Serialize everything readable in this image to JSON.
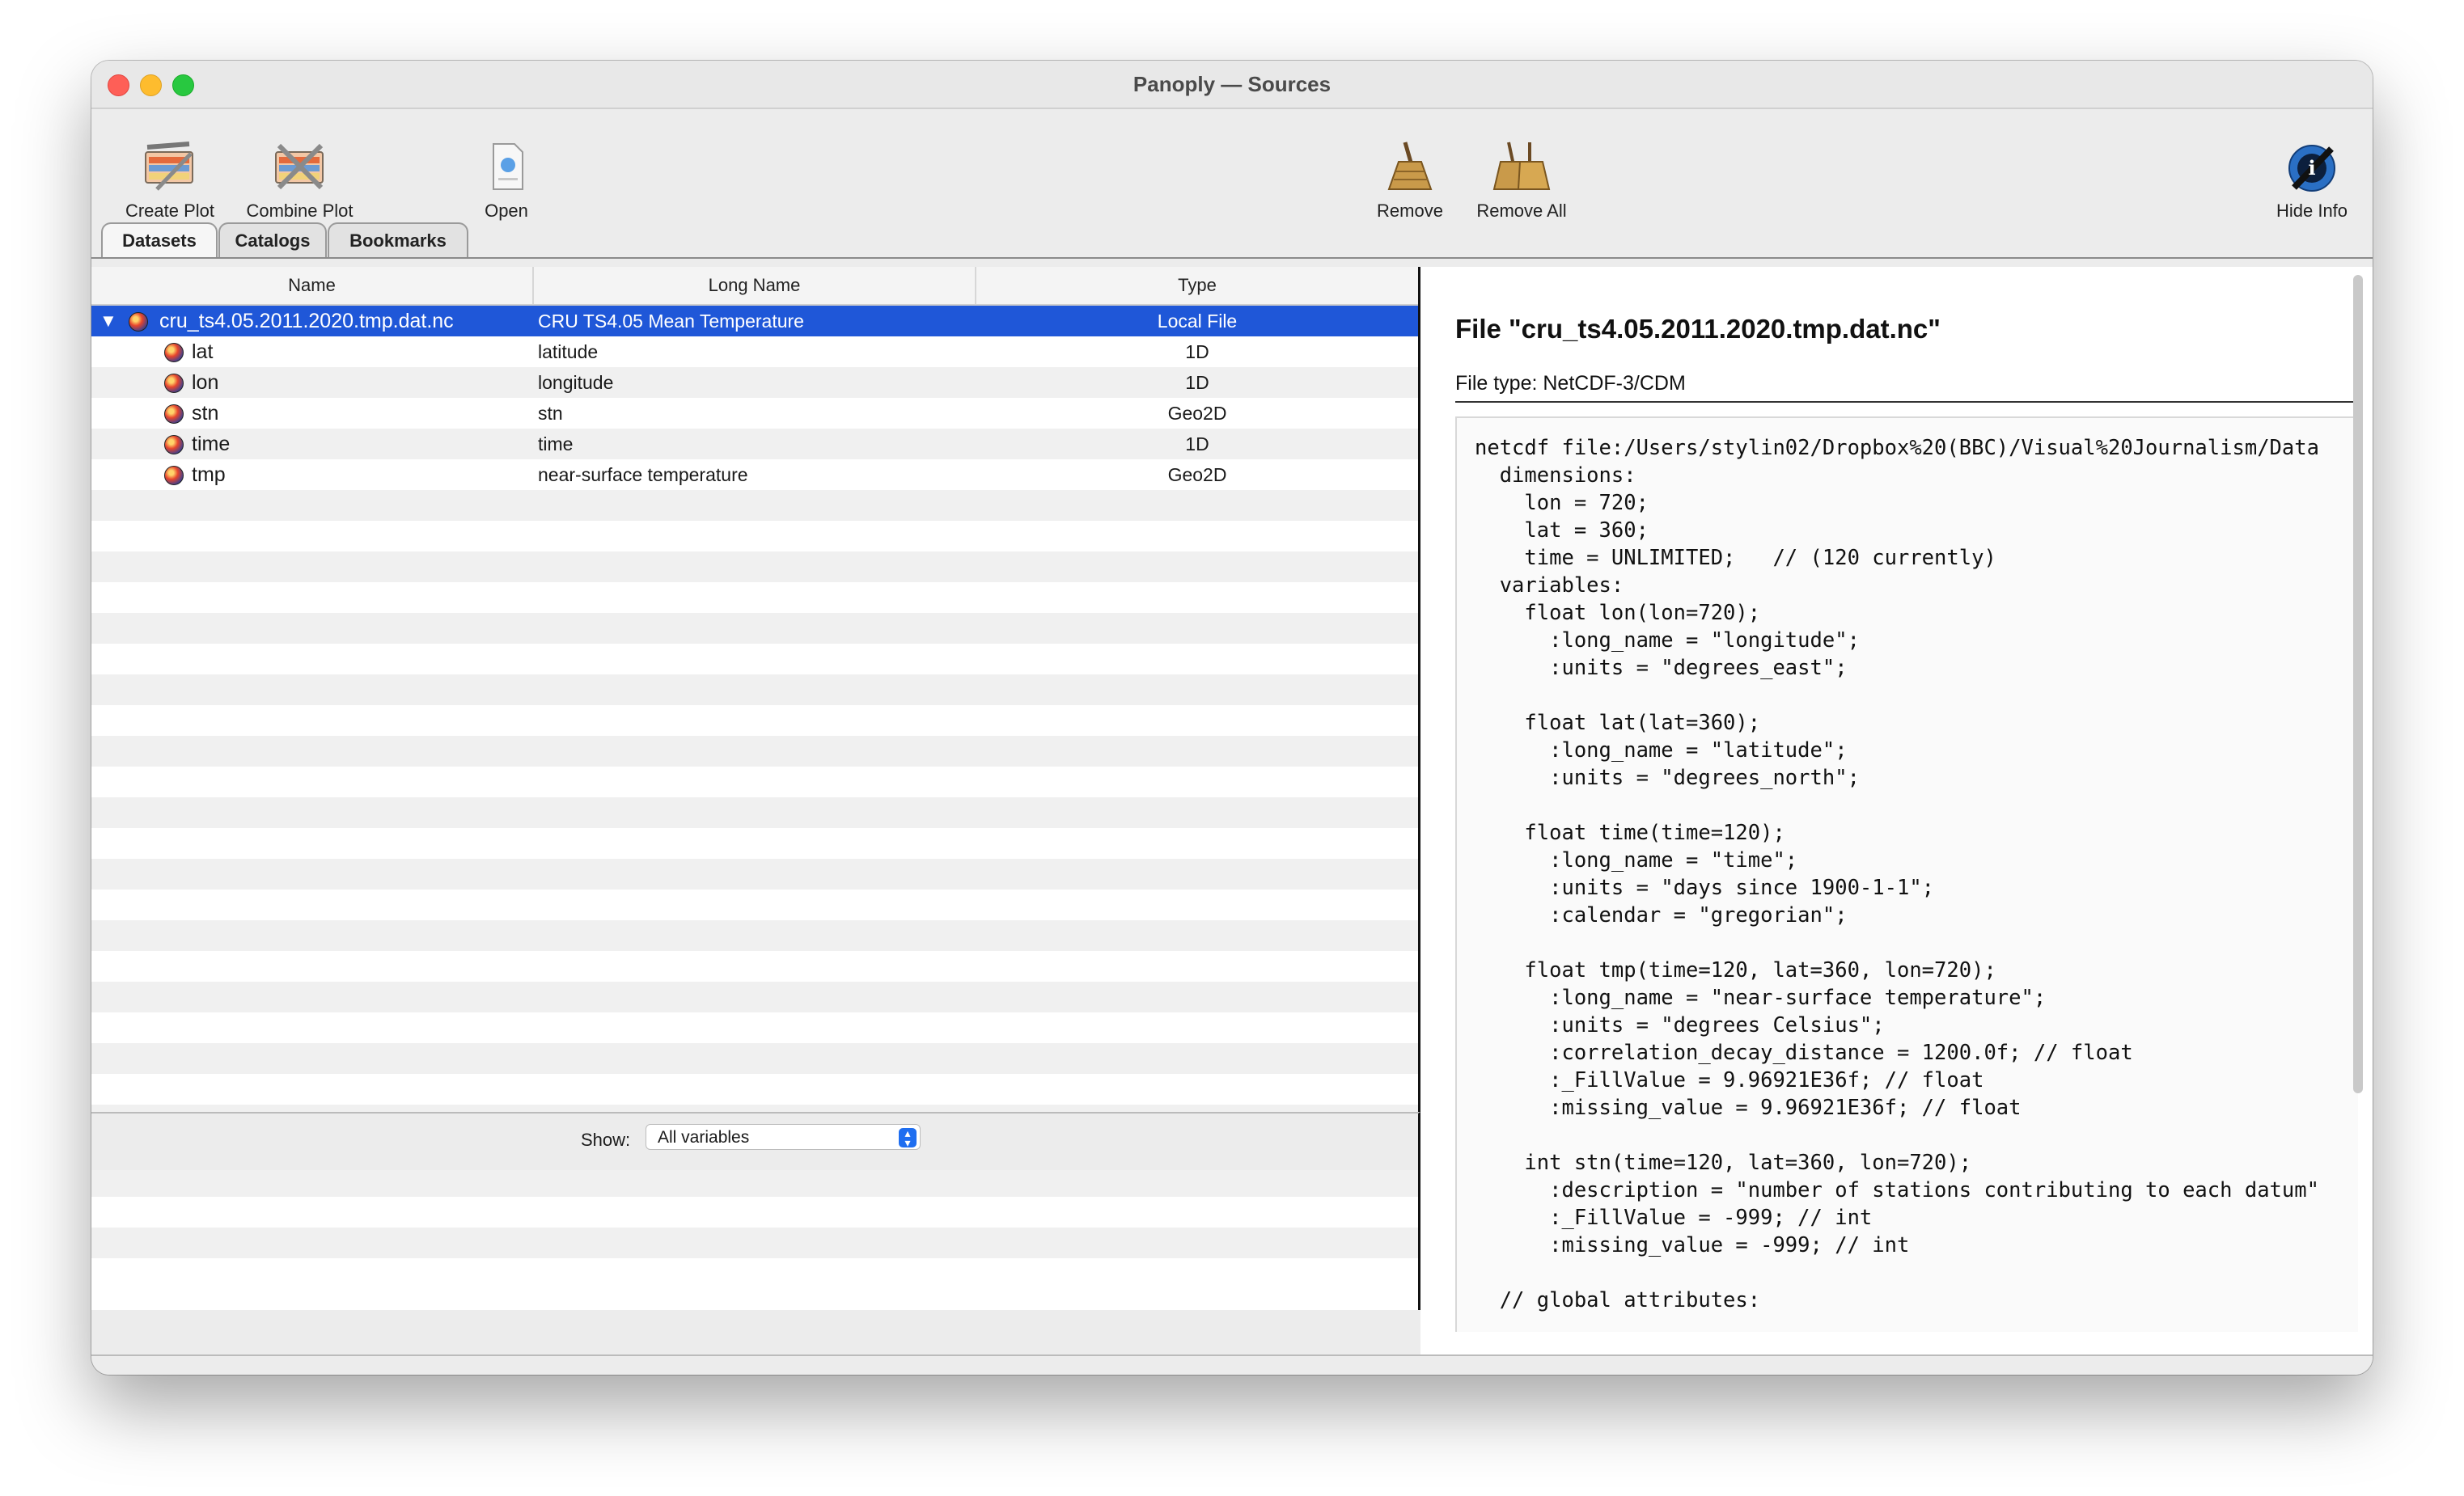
{
  "window": {
    "title": "Panoply — Sources"
  },
  "toolbar": {
    "create_plot": "Create Plot",
    "combine_plot": "Combine Plot",
    "open": "Open",
    "remove": "Remove",
    "remove_all": "Remove All",
    "hide_info": "Hide Info"
  },
  "tabs": [
    "Datasets",
    "Catalogs",
    "Bookmarks"
  ],
  "table": {
    "columns": [
      "Name",
      "Long Name",
      "Type"
    ],
    "rows": [
      {
        "name": "cru_ts4.05.2011.2020.tmp.dat.nc",
        "long_name": "CRU TS4.05 Mean Temperature",
        "type": "Local File"
      },
      {
        "name": "lat",
        "long_name": "latitude",
        "type": "1D"
      },
      {
        "name": "lon",
        "long_name": "longitude",
        "type": "1D"
      },
      {
        "name": "stn",
        "long_name": "stn",
        "type": "Geo2D"
      },
      {
        "name": "time",
        "long_name": "time",
        "type": "1D"
      },
      {
        "name": "tmp",
        "long_name": "near-surface temperature",
        "type": "Geo2D"
      }
    ]
  },
  "footer": {
    "show_label": "Show:",
    "show_value": "All variables"
  },
  "info": {
    "file_title": "File \"cru_ts4.05.2011.2020.tmp.dat.nc\"",
    "file_type": "File type: NetCDF-3/CDM",
    "code": "netcdf file:/Users/stylin02/Dropbox%20(BBC)/Visual%20Journalism/Data\n  dimensions:\n    lon = 720;\n    lat = 360;\n    time = UNLIMITED;   // (120 currently)\n  variables:\n    float lon(lon=720);\n      :long_name = \"longitude\";\n      :units = \"degrees_east\";\n\n    float lat(lat=360);\n      :long_name = \"latitude\";\n      :units = \"degrees_north\";\n\n    float time(time=120);\n      :long_name = \"time\";\n      :units = \"days since 1900-1-1\";\n      :calendar = \"gregorian\";\n\n    float tmp(time=120, lat=360, lon=720);\n      :long_name = \"near-surface temperature\";\n      :units = \"degrees Celsius\";\n      :correlation_decay_distance = 1200.0f; // float\n      :_FillValue = 9.96921E36f; // float\n      :missing_value = 9.96921E36f; // float\n\n    int stn(time=120, lat=360, lon=720);\n      :description = \"number of stations contributing to each datum\"\n      :_FillValue = -999; // int\n      :missing_value = -999; // int\n\n  // global attributes:"
  }
}
